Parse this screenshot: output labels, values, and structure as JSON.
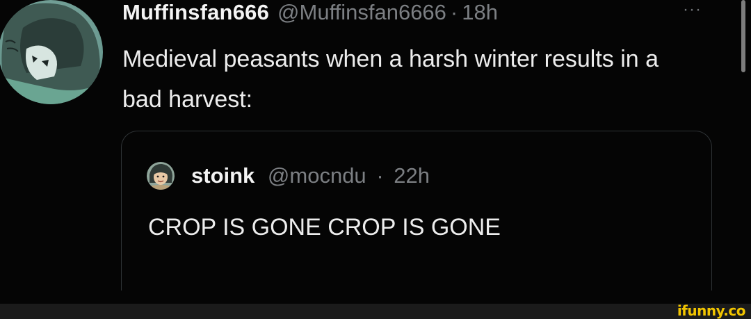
{
  "tweet": {
    "display_name": "Muffinsfan666",
    "handle": "@Muffinsfan6666",
    "separator": "·",
    "time": "18h",
    "more_icon": "···",
    "text": "Medieval peasants when a harsh winter results in a bad harvest:",
    "avatar_icon": "profile-picture"
  },
  "quoted_tweet": {
    "display_name": "stoink",
    "handle": "@mocndu",
    "separator": "·",
    "time": "22h",
    "text": "CROP IS GONE CROP IS GONE",
    "avatar_icon": "profile-picture"
  },
  "watermark": {
    "text": "ifunny.co"
  },
  "colors": {
    "background": "#050505",
    "secondary_text": "#7c7f83",
    "primary_text": "#ededed",
    "border": "#2f3336",
    "watermark": "#f1c400"
  }
}
